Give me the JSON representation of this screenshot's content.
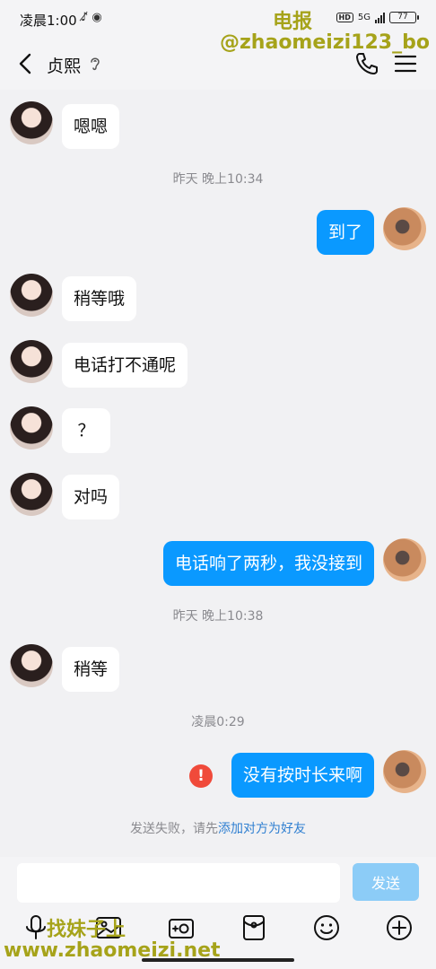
{
  "status_bar": {
    "time": "凌晨1:00",
    "left_icons": "♪̸ ◉",
    "network": "5G",
    "hd": "HD",
    "battery": "77"
  },
  "header": {
    "contact_name": "贞熙"
  },
  "messages": [
    {
      "side": "in",
      "text": "嗯嗯"
    },
    {
      "side": "time",
      "text": "昨天 晚上10:34"
    },
    {
      "side": "out",
      "text": "到了"
    },
    {
      "side": "in",
      "text": "稍等哦"
    },
    {
      "side": "in",
      "text": "电话打不通呢"
    },
    {
      "side": "in",
      "text": "？"
    },
    {
      "side": "in",
      "text": "对吗"
    },
    {
      "side": "out",
      "text": "电话响了两秒，我没接到"
    },
    {
      "side": "time",
      "text": "昨天 晚上10:38"
    },
    {
      "side": "in",
      "text": "稍等"
    },
    {
      "side": "time",
      "text": "凌晨0:29"
    },
    {
      "side": "out",
      "text": "没有按时长来啊",
      "failed": true
    }
  ],
  "fail_note": {
    "prefix": "发送失败，请先",
    "link": "添加对方为好友"
  },
  "input_bar": {
    "placeholder": "",
    "send_label": "发送"
  },
  "watermarks": {
    "top_line1": "电报",
    "top_line2": "@zhaomeizi123_bo",
    "bottom_line1": "找妹子上",
    "bottom_line2": "www.zhaomeizi.net"
  },
  "colors": {
    "outgoing_bubble": "#0a99ff",
    "incoming_bubble": "#ffffff",
    "send_button": "#8cccf7",
    "error": "#f04a3a",
    "link": "#2f7fd1"
  }
}
